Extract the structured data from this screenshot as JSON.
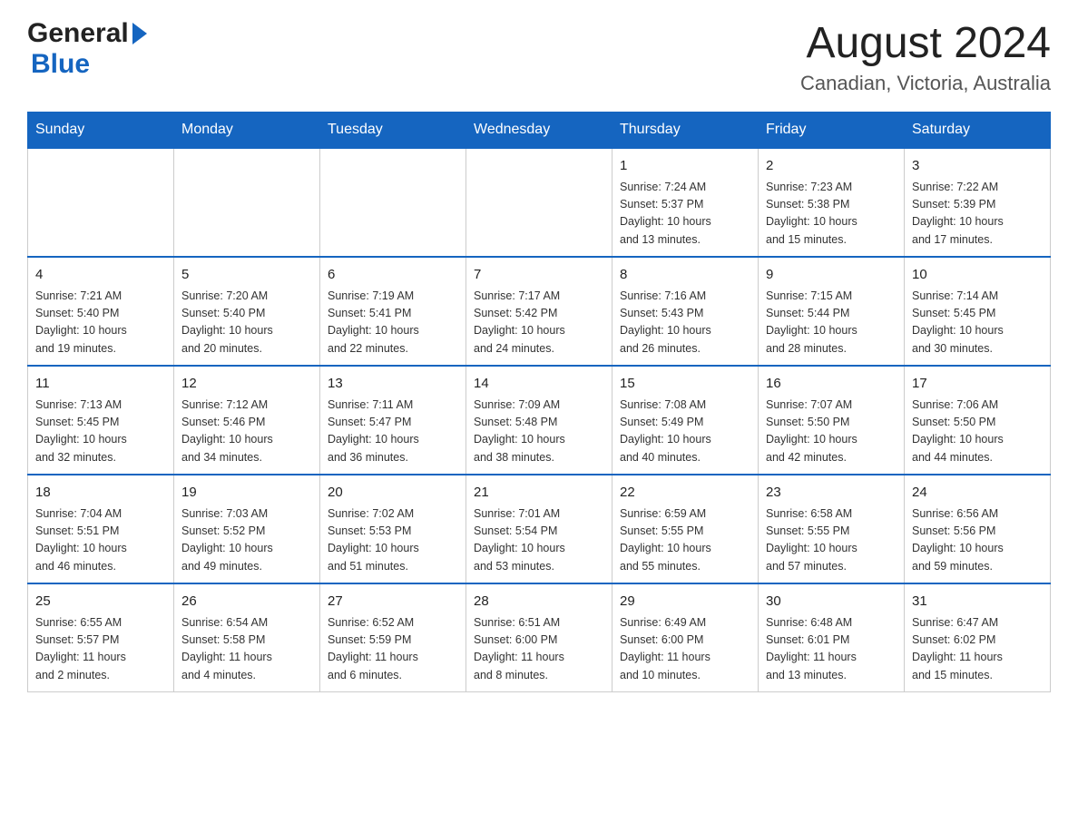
{
  "header": {
    "logo_general": "General",
    "logo_blue": "Blue",
    "title": "August 2024",
    "subtitle": "Canadian, Victoria, Australia"
  },
  "calendar": {
    "days_of_week": [
      "Sunday",
      "Monday",
      "Tuesday",
      "Wednesday",
      "Thursday",
      "Friday",
      "Saturday"
    ],
    "weeks": [
      [
        {
          "day": "",
          "info": ""
        },
        {
          "day": "",
          "info": ""
        },
        {
          "day": "",
          "info": ""
        },
        {
          "day": "",
          "info": ""
        },
        {
          "day": "1",
          "info": "Sunrise: 7:24 AM\nSunset: 5:37 PM\nDaylight: 10 hours\nand 13 minutes."
        },
        {
          "day": "2",
          "info": "Sunrise: 7:23 AM\nSunset: 5:38 PM\nDaylight: 10 hours\nand 15 minutes."
        },
        {
          "day": "3",
          "info": "Sunrise: 7:22 AM\nSunset: 5:39 PM\nDaylight: 10 hours\nand 17 minutes."
        }
      ],
      [
        {
          "day": "4",
          "info": "Sunrise: 7:21 AM\nSunset: 5:40 PM\nDaylight: 10 hours\nand 19 minutes."
        },
        {
          "day": "5",
          "info": "Sunrise: 7:20 AM\nSunset: 5:40 PM\nDaylight: 10 hours\nand 20 minutes."
        },
        {
          "day": "6",
          "info": "Sunrise: 7:19 AM\nSunset: 5:41 PM\nDaylight: 10 hours\nand 22 minutes."
        },
        {
          "day": "7",
          "info": "Sunrise: 7:17 AM\nSunset: 5:42 PM\nDaylight: 10 hours\nand 24 minutes."
        },
        {
          "day": "8",
          "info": "Sunrise: 7:16 AM\nSunset: 5:43 PM\nDaylight: 10 hours\nand 26 minutes."
        },
        {
          "day": "9",
          "info": "Sunrise: 7:15 AM\nSunset: 5:44 PM\nDaylight: 10 hours\nand 28 minutes."
        },
        {
          "day": "10",
          "info": "Sunrise: 7:14 AM\nSunset: 5:45 PM\nDaylight: 10 hours\nand 30 minutes."
        }
      ],
      [
        {
          "day": "11",
          "info": "Sunrise: 7:13 AM\nSunset: 5:45 PM\nDaylight: 10 hours\nand 32 minutes."
        },
        {
          "day": "12",
          "info": "Sunrise: 7:12 AM\nSunset: 5:46 PM\nDaylight: 10 hours\nand 34 minutes."
        },
        {
          "day": "13",
          "info": "Sunrise: 7:11 AM\nSunset: 5:47 PM\nDaylight: 10 hours\nand 36 minutes."
        },
        {
          "day": "14",
          "info": "Sunrise: 7:09 AM\nSunset: 5:48 PM\nDaylight: 10 hours\nand 38 minutes."
        },
        {
          "day": "15",
          "info": "Sunrise: 7:08 AM\nSunset: 5:49 PM\nDaylight: 10 hours\nand 40 minutes."
        },
        {
          "day": "16",
          "info": "Sunrise: 7:07 AM\nSunset: 5:50 PM\nDaylight: 10 hours\nand 42 minutes."
        },
        {
          "day": "17",
          "info": "Sunrise: 7:06 AM\nSunset: 5:50 PM\nDaylight: 10 hours\nand 44 minutes."
        }
      ],
      [
        {
          "day": "18",
          "info": "Sunrise: 7:04 AM\nSunset: 5:51 PM\nDaylight: 10 hours\nand 46 minutes."
        },
        {
          "day": "19",
          "info": "Sunrise: 7:03 AM\nSunset: 5:52 PM\nDaylight: 10 hours\nand 49 minutes."
        },
        {
          "day": "20",
          "info": "Sunrise: 7:02 AM\nSunset: 5:53 PM\nDaylight: 10 hours\nand 51 minutes."
        },
        {
          "day": "21",
          "info": "Sunrise: 7:01 AM\nSunset: 5:54 PM\nDaylight: 10 hours\nand 53 minutes."
        },
        {
          "day": "22",
          "info": "Sunrise: 6:59 AM\nSunset: 5:55 PM\nDaylight: 10 hours\nand 55 minutes."
        },
        {
          "day": "23",
          "info": "Sunrise: 6:58 AM\nSunset: 5:55 PM\nDaylight: 10 hours\nand 57 minutes."
        },
        {
          "day": "24",
          "info": "Sunrise: 6:56 AM\nSunset: 5:56 PM\nDaylight: 10 hours\nand 59 minutes."
        }
      ],
      [
        {
          "day": "25",
          "info": "Sunrise: 6:55 AM\nSunset: 5:57 PM\nDaylight: 11 hours\nand 2 minutes."
        },
        {
          "day": "26",
          "info": "Sunrise: 6:54 AM\nSunset: 5:58 PM\nDaylight: 11 hours\nand 4 minutes."
        },
        {
          "day": "27",
          "info": "Sunrise: 6:52 AM\nSunset: 5:59 PM\nDaylight: 11 hours\nand 6 minutes."
        },
        {
          "day": "28",
          "info": "Sunrise: 6:51 AM\nSunset: 6:00 PM\nDaylight: 11 hours\nand 8 minutes."
        },
        {
          "day": "29",
          "info": "Sunrise: 6:49 AM\nSunset: 6:00 PM\nDaylight: 11 hours\nand 10 minutes."
        },
        {
          "day": "30",
          "info": "Sunrise: 6:48 AM\nSunset: 6:01 PM\nDaylight: 11 hours\nand 13 minutes."
        },
        {
          "day": "31",
          "info": "Sunrise: 6:47 AM\nSunset: 6:02 PM\nDaylight: 11 hours\nand 15 minutes."
        }
      ]
    ]
  }
}
